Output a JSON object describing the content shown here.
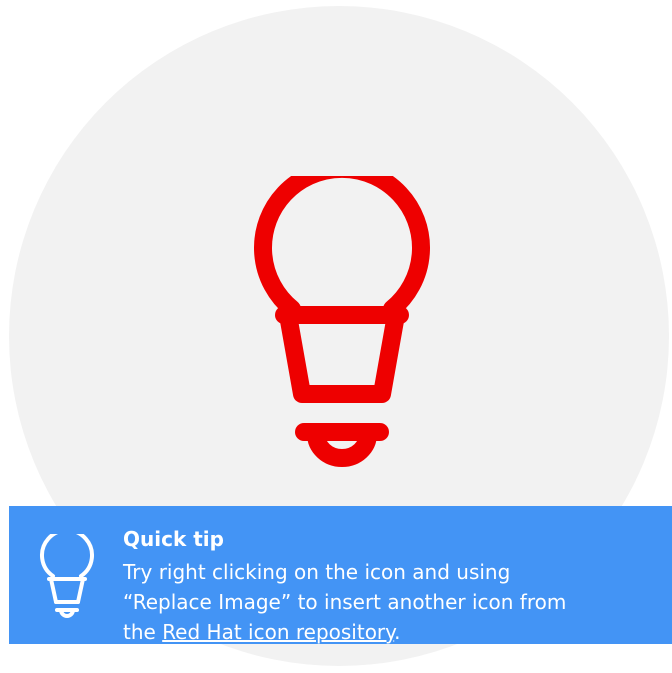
{
  "colors": {
    "accent_red": "#ee0000",
    "circle_bg": "#f2f2f2",
    "tip_bg": "#4394f5",
    "tip_text": "#ffffff"
  },
  "icon": {
    "main": "lightbulb-icon",
    "tip": "lightbulb-outline-icon"
  },
  "tip": {
    "title": "Quick tip",
    "line1": "Try right clicking on the icon and using",
    "line2": "“Replace Image” to insert another icon from",
    "line3_prefix": "the ",
    "link_text": "Red Hat icon repository",
    "line3_suffix": "."
  }
}
